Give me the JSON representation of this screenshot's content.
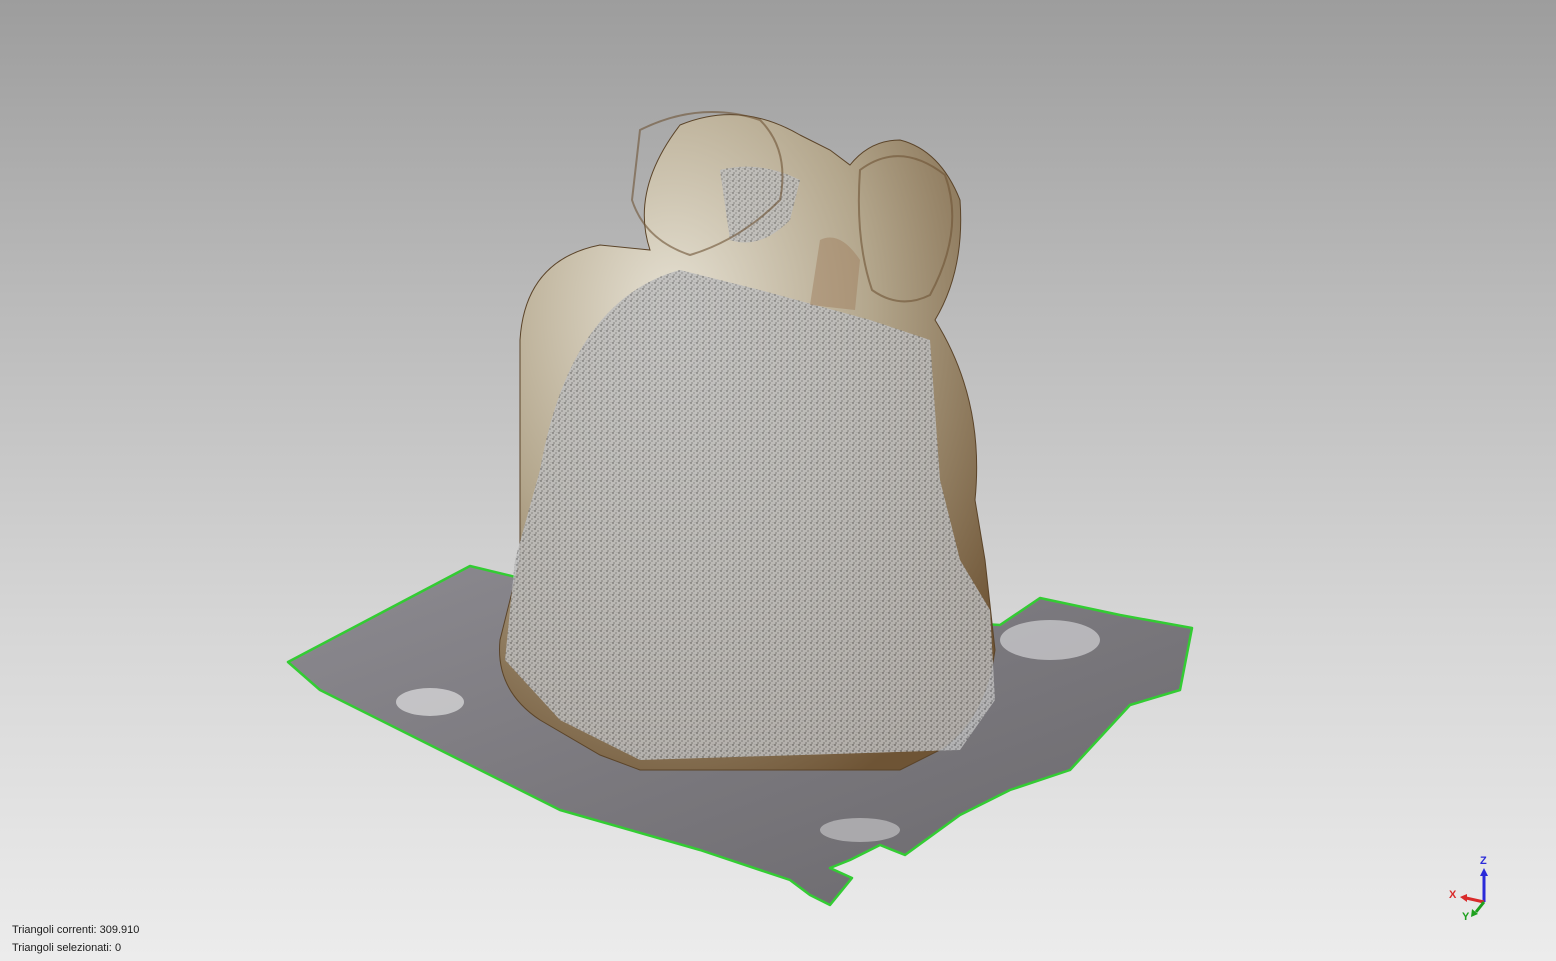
{
  "status": {
    "current_triangles_label": "Triangoli correnti:",
    "current_triangles_value": "309.910",
    "selected_triangles_label": "Triangoli selezionati:",
    "selected_triangles_value": "0"
  },
  "axes": {
    "z": "Z",
    "x": "X",
    "y": "Y"
  },
  "colors": {
    "boundary_edge": "#33cc33",
    "axis_x": "#d92b2b",
    "axis_y": "#1ea01e",
    "axis_z": "#2b2bd9",
    "mesh_surface": "#807e84",
    "statue_surface": "#a79c88"
  }
}
